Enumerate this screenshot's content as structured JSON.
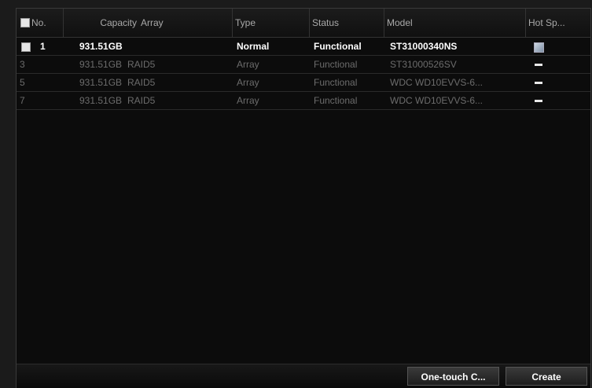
{
  "table": {
    "columns": {
      "no": "No.",
      "capacity": "Capacity",
      "array": "Array",
      "type": "Type",
      "status": "Status",
      "model": "Model",
      "hot_spare": "Hot Sp..."
    },
    "rows": [
      {
        "no": "1",
        "capacity": "931.51GB",
        "array": "",
        "type": "Normal",
        "status": "Functional",
        "model": "ST31000340NS",
        "hot_spare": "checked-icon",
        "selected": true
      },
      {
        "no": "3",
        "capacity": "931.51GB",
        "array": "RAID5",
        "type": "Array",
        "status": "Functional",
        "model": "ST31000526SV",
        "hot_spare": "dash-icon",
        "selected": false
      },
      {
        "no": "5",
        "capacity": "931.51GB",
        "array": "RAID5",
        "type": "Array",
        "status": "Functional",
        "model": "WDC WD10EVVS-6...",
        "hot_spare": "dash-icon",
        "selected": false
      },
      {
        "no": "7",
        "capacity": "931.51GB",
        "array": "RAID5",
        "type": "Array",
        "status": "Functional",
        "model": "WDC WD10EVVS-6...",
        "hot_spare": "dash-icon",
        "selected": false
      }
    ]
  },
  "buttons": {
    "one_touch": "One-touch C...",
    "create": "Create"
  }
}
